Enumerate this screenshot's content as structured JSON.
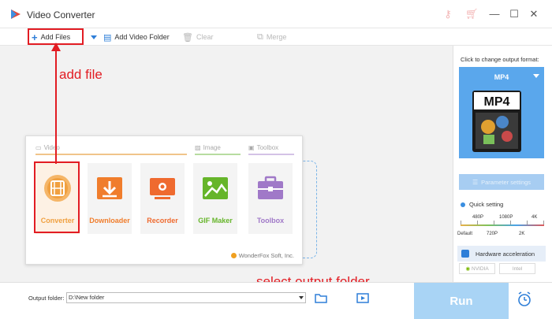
{
  "window": {
    "title": "Video Converter",
    "icons": [
      "key-icon",
      "cart-icon"
    ],
    "controls": [
      "minimize",
      "maximize",
      "close"
    ]
  },
  "toolbar": {
    "add_files": "Add Files",
    "add_video_folder": "Add Video Folder",
    "clear": "Clear",
    "merge": "Merge"
  },
  "launcher": {
    "sections": {
      "video": "Video",
      "image": "Image",
      "toolbox": "Toolbox"
    },
    "tiles": [
      {
        "label": "Converter",
        "icon": "film-icon"
      },
      {
        "label": "Downloader",
        "icon": "download-icon"
      },
      {
        "label": "Recorder",
        "icon": "screen-record-icon"
      },
      {
        "label": "GIF Maker",
        "icon": "image-icon"
      },
      {
        "label": "Toolbox",
        "icon": "toolbox-icon"
      }
    ],
    "brand": "WonderFox Soft, Inc."
  },
  "annotations": {
    "add_file": "add file",
    "select_output_folder": "select output folder"
  },
  "output": {
    "caption": "Click to change output format:",
    "format": "MP4",
    "format_badge": "MP4",
    "parameter_settings": "Parameter settings",
    "quick_setting": "Quick setting",
    "quality_top": [
      "480P",
      "1080P",
      "4K"
    ],
    "quality_bottom": [
      "Default",
      "720P",
      "2K"
    ],
    "hardware_acceleration": "Hardware acceleration",
    "gpu_options": [
      "NVIDIA",
      "Intel"
    ]
  },
  "bottom": {
    "output_folder_label": "Output folder:",
    "output_folder_value": "D:\\New folder",
    "run": "Run"
  },
  "colors": {
    "accent": "#5aa7ec",
    "highlight": "#e21c23",
    "converter": "#f0a040",
    "downloader": "#f07d2c",
    "recorder": "#ef6a2f",
    "gif_maker": "#66b52a",
    "toolbox": "#a079c8"
  }
}
